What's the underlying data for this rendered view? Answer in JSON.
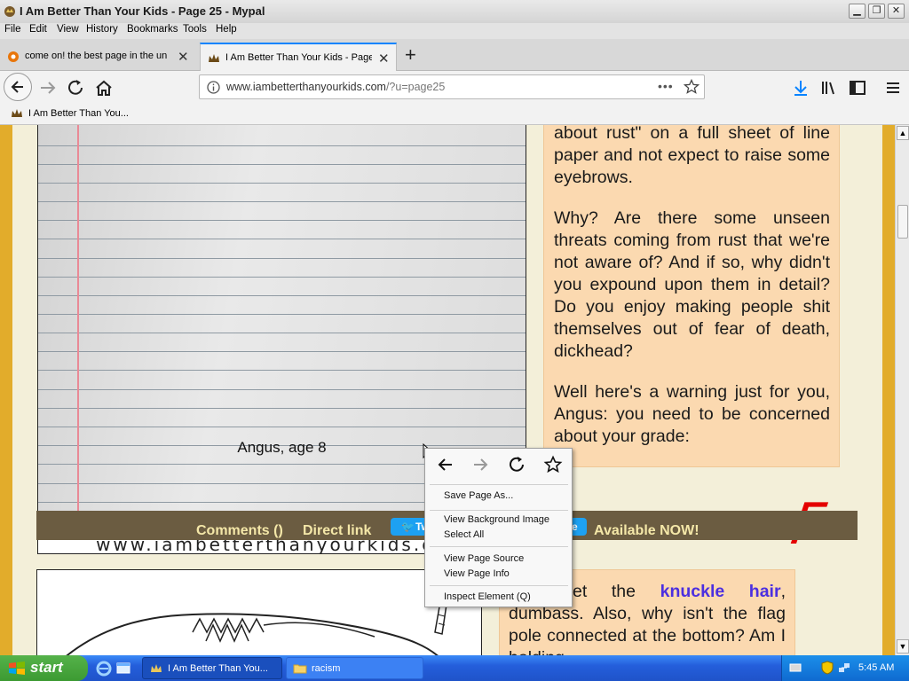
{
  "window": {
    "title": "I Am Better Than Your Kids - Page 25 - Mypal",
    "controls": {
      "minimize": "▁",
      "restore": "❐",
      "close": "✕"
    }
  },
  "menubar": [
    "File",
    "Edit",
    "View",
    "History",
    "Bookmarks",
    "Tools",
    "Help"
  ],
  "tabs": [
    {
      "label": "come on! the best page in the uni",
      "icon": "page-favicon"
    },
    {
      "label": "I Am Better Than Your Kids - Page",
      "icon": "crown-favicon"
    }
  ],
  "new_tab": "+",
  "urlbar": {
    "host": "www.iambetterthanyourkids.com",
    "path": "/?u=page25",
    "more": "•••"
  },
  "bookmarks": [
    {
      "label": "I Am Better Than You...",
      "icon": "crown-favicon"
    }
  ],
  "article1": {
    "watermark": "www.iambetterthanyourkids.com",
    "caption": "Angus, age 8",
    "critique": [
      "about rust\" on a full sheet of line paper and not expect to raise some eyebrows.",
      "Why? Are there some unseen threats coming from rust that we're not aware of? And if so, why didn't you expound upon them in detail? Do you enjoy making people shit themselves out of fear of death, dickhead?",
      "Well here's a warning just for you, Angus: you need to be concerned about your grade:"
    ],
    "grade": "F"
  },
  "strip": {
    "comments": "Comments ()",
    "direct_link": "Direct link",
    "tweet": "Tw",
    "share_suffix": "e",
    "available": "Available NOW!"
  },
  "article2": {
    "pre": "o forget the ",
    "link": "knuckle hair",
    "post": ", dumbass. Also, why isn't the flag pole connected at the bottom? Am I holding"
  },
  "context_menu": {
    "items": [
      "Save Page As...",
      "View Background Image",
      "Select All",
      "View Page Source",
      "View Page Info",
      "Inspect Element (Q)"
    ]
  },
  "taskbar": {
    "start": "start",
    "buttons": [
      {
        "label": "I Am Better Than You...",
        "icon": "crown-favicon"
      },
      {
        "label": "racism",
        "icon": "folder-icon"
      }
    ],
    "clock": "5:45 AM"
  },
  "colors": {
    "accent": "#0a84ff",
    "page_bg": "#f3efd9",
    "critique_bg": "#fbd9b0",
    "strip_bg": "#6b5c41",
    "link": "#4b2fe0",
    "grade": "#e40000"
  }
}
